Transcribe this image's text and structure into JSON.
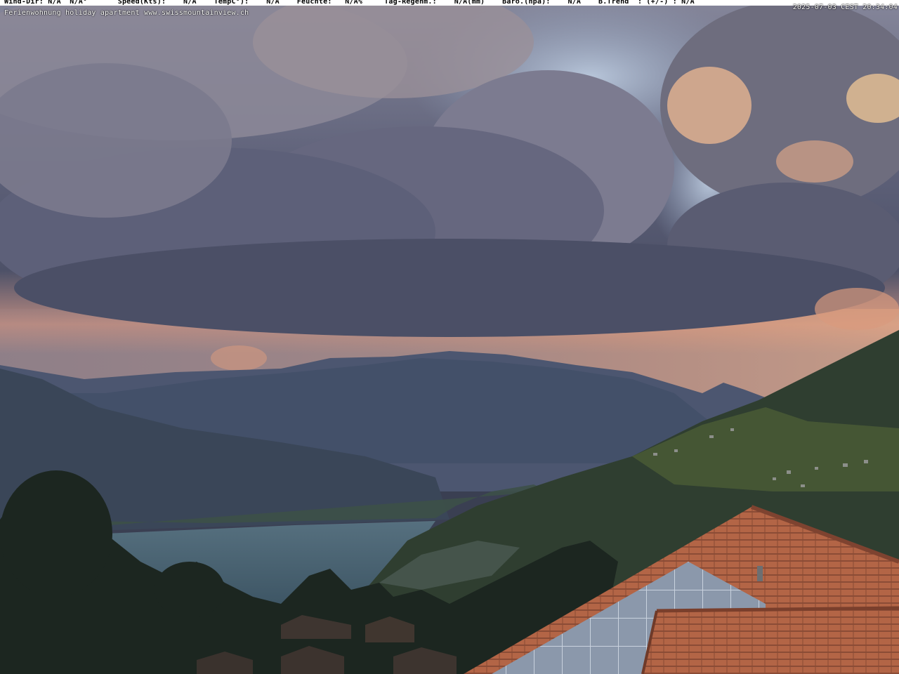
{
  "overlay": {
    "weather_line": "Wind-Dir: N/A  N/A°       Speed(Kts):    N/A    TempC°):    N/A    Feuchte:   N/A%     Tag-Regenm.:    N/A(mm)    Baro.(hpa):    N/A    B.Trend  : (+/-) : N/A",
    "timestamp": "2025-07-03 CEST 20:34:04",
    "caption": "Ferienwohnung holiday apartment www.swissmountainview.ch"
  },
  "colors": {
    "sky_top": "#7d7f93",
    "sky_blue": "#a9b8cf",
    "cloud_dark": "#4b4f66",
    "sunset_glow": "#e8a47f",
    "mountains": "#3f4a63",
    "lake": "#4d6678",
    "hillside": "#2f3d30",
    "roof_tiles": "#b8694a",
    "solar_panel": "#8a98ab"
  }
}
